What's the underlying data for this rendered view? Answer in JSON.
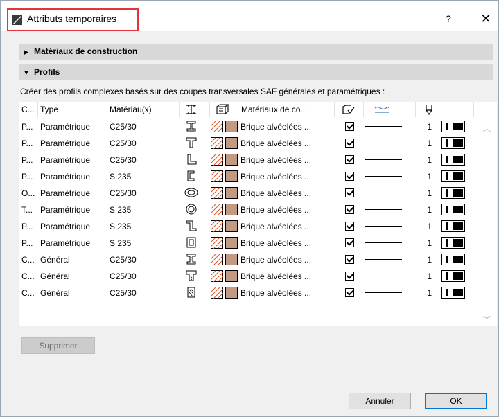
{
  "window": {
    "title": "Attributs temporaires",
    "help_label": "?",
    "close_label": "✕"
  },
  "sections": [
    {
      "label": "Matériaux de construction",
      "expanded": false
    },
    {
      "label": "Profils",
      "expanded": true
    }
  ],
  "description": "Créer des profils complexes basés sur des coupes transversales SAF générales et paramétriques :",
  "table": {
    "headers": {
      "c": "C...",
      "type": "Type",
      "material": "Matériau(x)",
      "building_materials": "Matériaux de co..."
    },
    "rows": [
      {
        "c": "P...",
        "type": "Paramétrique",
        "material": "C25/30",
        "building_material": "Brique alvéolées ...",
        "count": "1",
        "icon": "i-beam"
      },
      {
        "c": "P...",
        "type": "Paramétrique",
        "material": "C25/30",
        "building_material": "Brique alvéolées ...",
        "count": "1",
        "icon": "t-beam"
      },
      {
        "c": "P...",
        "type": "Paramétrique",
        "material": "C25/30",
        "building_material": "Brique alvéolées ...",
        "count": "1",
        "icon": "l-angle"
      },
      {
        "c": "P...",
        "type": "Paramétrique",
        "material": "S 235",
        "building_material": "Brique alvéolées ...",
        "count": "1",
        "icon": "c-channel"
      },
      {
        "c": "O...",
        "type": "Paramétrique",
        "material": "C25/30",
        "building_material": "Brique alvéolées ...",
        "count": "1",
        "icon": "oval"
      },
      {
        "c": "T...",
        "type": "Paramétrique",
        "material": "S 235",
        "building_material": "Brique alvéolées ...",
        "count": "1",
        "icon": "circle-tube"
      },
      {
        "c": "P...",
        "type": "Paramétrique",
        "material": "S 235",
        "building_material": "Brique alvéolées ...",
        "count": "1",
        "icon": "z-profile"
      },
      {
        "c": "P...",
        "type": "Paramétrique",
        "material": "S 235",
        "building_material": "Brique alvéolées ...",
        "count": "1",
        "icon": "box-profile"
      },
      {
        "c": "C...",
        "type": "Général",
        "material": "C25/30",
        "building_material": "Brique alvéolées ...",
        "count": "1",
        "icon": "i-beam-general"
      },
      {
        "c": "C...",
        "type": "Général",
        "material": "C25/30",
        "building_material": "Brique alvéolées ...",
        "count": "1",
        "icon": "t-beam-general"
      },
      {
        "c": "C...",
        "type": "Général",
        "material": "C25/30",
        "building_material": "Brique alvéolées ...",
        "count": "1",
        "icon": "trapezoid-general"
      }
    ]
  },
  "buttons": {
    "delete": "Supprimer",
    "cancel": "Annuler",
    "ok": "OK"
  },
  "colors": {
    "highlight": "#e3343b",
    "surface_fill": "#c29a82",
    "hatch": "#e1582a",
    "section_bg": "#d8d8d8"
  }
}
